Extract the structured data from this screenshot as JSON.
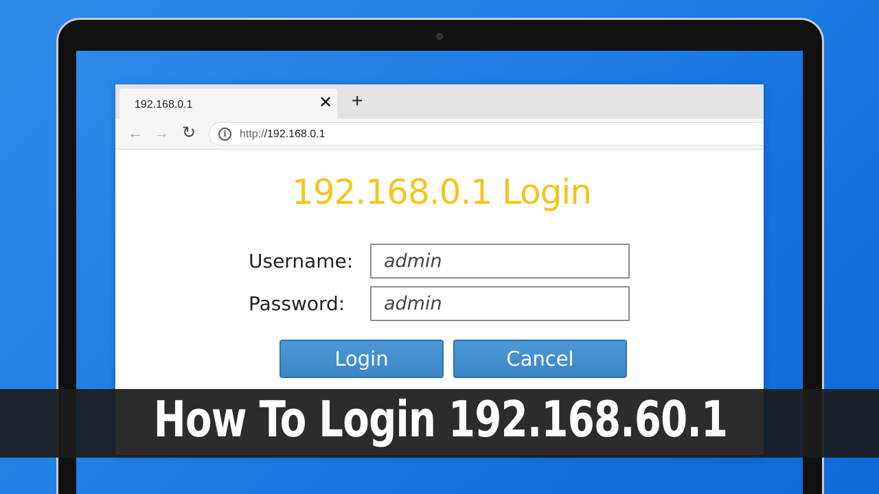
{
  "browser": {
    "tab_title": "192.168.0.1",
    "tab_close": "✕",
    "new_tab": "+",
    "nav_back": "←",
    "nav_forward": "→",
    "nav_reload": "↻",
    "info_icon": "i",
    "url_protocol": "http:/",
    "url_host": "/192.168.0.1"
  },
  "login": {
    "title": "192.168.0.1 Login",
    "username_label": "Username:",
    "password_label": "Password:",
    "username_value": "admin",
    "password_value": "admin",
    "login_button": "Login",
    "cancel_button": "Cancel"
  },
  "banner": {
    "text": "How To Login 192.168.60.1"
  },
  "colors": {
    "background": "#1f7fe6",
    "title": "#f5c51d",
    "button": "#4390cf",
    "banner": "#1c1c1c"
  }
}
